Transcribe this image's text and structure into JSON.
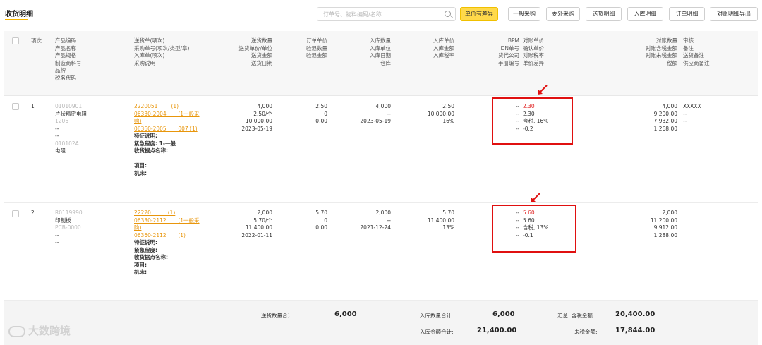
{
  "page_title": "收货明细",
  "search": {
    "placeholder": "订单号、物料编码/名称"
  },
  "buttons": [
    "单价有差异",
    "一般采购",
    "委外采购",
    "送货明细",
    "入库明细",
    "订单明细",
    "对账明细导出"
  ],
  "headers": {
    "seq": "项次",
    "product": [
      "产品编码",
      "产品名称",
      "产品规格",
      "制造商料号",
      "品牌",
      "税务代码"
    ],
    "delivery": [
      "送货单(项次)",
      "采购单号(项次/类型/章)",
      "入库单(项次)",
      "采购说明"
    ],
    "delivery_qty": [
      "送货数量",
      "送货单价/单位",
      "送货金额",
      "送货日期"
    ],
    "order": [
      "订单单价",
      "验退数量",
      "验退金额"
    ],
    "stock_in": [
      "入库数量",
      "入库单位",
      "入库日期",
      "仓库"
    ],
    "stock_price": [
      "入库单价",
      "入库金额",
      "入库税率"
    ],
    "bpm": [
      "BPM",
      "IDN单号",
      "货代公司",
      "手册编号"
    ],
    "recon_price": [
      "对账单价",
      "确认单价",
      "对账税率",
      "单价差异"
    ],
    "recon_qty": [
      "对账数量",
      "对账含税金额",
      "对账未税金额",
      "税额"
    ],
    "audit": [
      "审核",
      "备注",
      "送货备注",
      "供应商备注"
    ]
  },
  "rows": [
    {
      "seq": "1",
      "product": [
        "01010901",
        "片状精密电阻",
        "1206",
        "--",
        "--",
        "010102A",
        "电阻"
      ],
      "delivery_links": [
        "2220051        (1)",
        "06330-2004       (1一般采",
        "购)",
        "06360-2005       007 (1)"
      ],
      "delivery_notes": [
        "特征说明:",
        "紧急程度: 1-一般",
        "收货据点名称:",
        "",
        "项目:",
        "机床:"
      ],
      "delivery_qty": [
        "4,000",
        "2.50/个",
        "10,000.00",
        "2023-05-19"
      ],
      "order": [
        "2.50",
        "0",
        "0.00"
      ],
      "stock_in": [
        "4,000",
        "--",
        "2023-05-19"
      ],
      "stock_price": [
        "2.50",
        "10,000.00",
        "16%"
      ],
      "bpm": [
        "--",
        "--",
        "--",
        "--"
      ],
      "recon_price": [
        "2.30",
        "2.30",
        "含税, 16%",
        "-0.2"
      ],
      "recon_qty": [
        "4,000",
        "9,200.00",
        "7,932.00",
        "1,268.00"
      ],
      "audit": [
        "XXXXX",
        "--",
        "--"
      ]
    },
    {
      "seq": "2",
      "product": [
        "R0119990",
        "印制板",
        "PCB-0000",
        "--",
        "--"
      ],
      "delivery_links": [
        "22220          (1)",
        "06330-2112       (1一般采",
        "购)",
        "06360-2112       (1)"
      ],
      "delivery_notes": [
        "特征说明:",
        "紧急程度:",
        "收货据点名称:",
        "项目:",
        "机床:"
      ],
      "delivery_qty": [
        "2,000",
        "5.70/个",
        "11,400.00",
        "2022-01-11"
      ],
      "order": [
        "5.70",
        "0",
        "0.00"
      ],
      "stock_in": [
        "2,000",
        "--",
        "2021-12-24"
      ],
      "stock_price": [
        "5.70",
        "11,400.00",
        "13%"
      ],
      "bpm": [
        "--",
        "--",
        "--",
        "--"
      ],
      "recon_price": [
        "5.60",
        "5.60",
        "含税, 13%",
        "-0.1"
      ],
      "recon_qty": [
        "2,000",
        "11,200.00",
        "9,912.00",
        "1,288.00"
      ],
      "audit": []
    }
  ],
  "footer": {
    "delivery_total_label": "送货数量合计:",
    "delivery_total": "6,000",
    "stock_qty_label": "入库数量合计:",
    "stock_qty": "6,000",
    "stock_amount_label": "入库金额合计:",
    "stock_amount": "21,400.00",
    "tax_incl_label": "汇总: 含税金额:",
    "tax_incl": "20,400.00",
    "tax_excl_label": "未税金额:",
    "tax_excl": "17,844.00"
  },
  "watermark": "大数跨境",
  "colors": {
    "accent": "#ffd94a",
    "link": "#e8960c",
    "highlight": "#e01010"
  }
}
